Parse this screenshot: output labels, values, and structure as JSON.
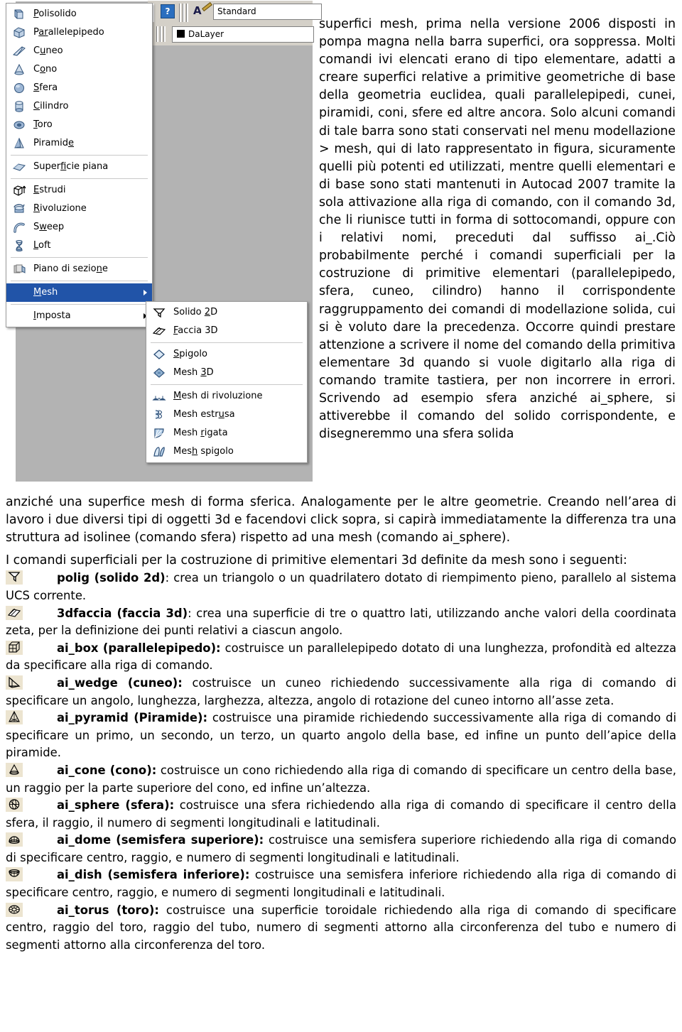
{
  "screenshot": {
    "toolbar": {
      "help_label": "?",
      "text_style_value": "Standard",
      "layer_value": "DaLayer"
    },
    "menu_main": {
      "items": [
        {
          "label": "Polisolido",
          "accel": "P",
          "icon": "polysolid-icon",
          "type": "item"
        },
        {
          "label": "Parallelepipedo",
          "accel": "ar",
          "icon": "box-icon",
          "type": "item"
        },
        {
          "label": "Cuneo",
          "accel": "u",
          "icon": "wedge-icon",
          "type": "item"
        },
        {
          "label": "Cono",
          "accel": "o",
          "icon": "cone-icon",
          "type": "item"
        },
        {
          "label": "Sfera",
          "accel": "S",
          "icon": "sphere-icon",
          "type": "item"
        },
        {
          "label": "Cilindro",
          "accel": "C",
          "icon": "cylinder-icon",
          "type": "item"
        },
        {
          "label": "Toro",
          "accel": "T",
          "icon": "torus-icon",
          "type": "item"
        },
        {
          "label": "Piramide",
          "accel": "d",
          "icon": "pyramid-icon",
          "type": "item"
        },
        {
          "type": "separator"
        },
        {
          "label": "Superficie piana",
          "accel": "f",
          "icon": "planar-surface-icon",
          "type": "item"
        },
        {
          "type": "separator"
        },
        {
          "label": "Estrudi",
          "accel": "E",
          "icon": "extrude-icon",
          "type": "item"
        },
        {
          "label": "Rivoluzione",
          "accel": "R",
          "icon": "revolve-icon",
          "type": "item"
        },
        {
          "label": "Sweep",
          "accel": "w",
          "icon": "sweep-icon",
          "type": "item"
        },
        {
          "label": "Loft",
          "accel": "L",
          "icon": "loft-icon",
          "type": "item"
        },
        {
          "type": "separator"
        },
        {
          "label": "Piano di sezione",
          "accel": "n",
          "icon": "section-plane-icon",
          "type": "item"
        },
        {
          "type": "separator"
        },
        {
          "label": "Mesh",
          "accel": "M",
          "icon": "none",
          "type": "submenu",
          "selected": true
        },
        {
          "type": "separator"
        },
        {
          "label": "Imposta",
          "accel": "I",
          "icon": "none",
          "type": "submenu"
        }
      ]
    },
    "menu_sub": {
      "items": [
        {
          "label": "Solido 2D",
          "accel": "2",
          "icon": "solid2d-icon",
          "type": "item"
        },
        {
          "label": "Faccia 3D",
          "accel": "F",
          "icon": "face3d-icon",
          "type": "item"
        },
        {
          "type": "separator"
        },
        {
          "label": "Spigolo",
          "accel": "S",
          "icon": "edge-icon",
          "type": "item"
        },
        {
          "label": "Mesh 3D",
          "accel": "3",
          "icon": "mesh3d-icon",
          "type": "item"
        },
        {
          "type": "separator"
        },
        {
          "label": "Mesh di rivoluzione",
          "accel": "M",
          "icon": "revolved-mesh-icon",
          "type": "item"
        },
        {
          "label": "Mesh estrusa",
          "accel": "u",
          "icon": "extruded-mesh-icon",
          "type": "item"
        },
        {
          "label": "Mesh rigata",
          "accel": "r",
          "icon": "ruled-mesh-icon",
          "type": "item"
        },
        {
          "label": "Mesh spigolo",
          "accel": "h",
          "icon": "edge-mesh-icon",
          "type": "item"
        }
      ]
    }
  },
  "body": {
    "right_column": "superfici mesh, prima nella versione 2006 disposti in pompa magna nella barra superfici, ora soppressa. Molti comandi ivi elencati erano di tipo elementare, adatti a creare superfici relative a primitive geometriche di base della geometria euclidea, quali parallelepipedi, cunei, piramidi, coni, sfere ed altre ancora. Solo alcuni comandi di tale barra sono stati conservati nel menu modellazione > mesh, qui di lato rappresentato in figura, sicuramente quelli più potenti ed utilizzati, mentre quelli elementari e di base sono stati mantenuti in Autocad 2007 tramite la sola attivazione alla riga di comando, con il comando 3d, che li riunisce tutti in forma di sottocomandi, oppure con i relativi nomi, preceduti dal suffisso ai_.Ciò probabilmente perché i comandi superficiali per la costruzione di primitive elementari (parallelepipedo, sfera, cuneo, cilindro) hanno il corrispondente raggruppamento dei comandi di modellazione solida, cui si è voluto dare la precedenza. Occorre quindi prestare attenzione a scrivere il nome del comando della primitiva elementare 3d quando si vuole digitarlo alla riga di comando tramite tastiera, per non incorrere in errori. Scrivendo ad esempio sfera anziché ai_sphere, si attiverebbe il comando del solido corrispondente, e disegneremmo una sfera solida",
    "continuation": "anziché una superfice mesh di forma sferica.    Analogamente per le altre geometrie. Creando nell’area di lavoro i due diversi tipi di oggetti 3d e facendovi click sopra, si capirà immediatamente la differenza tra una struttura ad isolinee (comando sfera) rispetto ad una mesh (comando ai_sphere).",
    "intro": " I comandi superficiali per la costruzione di primitive elementari 3d definite da mesh sono i seguenti:",
    "commands": [
      {
        "icon": "solid2d-icon",
        "name": "polig (solido 2d)",
        "sep": ": ",
        "desc": "crea un triangolo o un quadrilatero dotato di riempimento pieno, parallelo al sistema UCS corrente."
      },
      {
        "icon": "face3d-icon",
        "name": "3dfaccia (faccia 3d)",
        "sep": ": ",
        "desc": "crea una superficie di tre o quattro lati, utilizzando anche valori della coordinata zeta, per la definizione dei punti relativi a ciascun angolo."
      },
      {
        "icon": "box-wire-icon",
        "name": "ai_box (parallelepipedo):",
        "sep": " ",
        "desc": "costruisce un parallelepipedo dotato di una lunghezza, profondità ed altezza da specificare alla riga di comando."
      },
      {
        "icon": "wedge-wire-icon",
        "name": "ai_wedge (cuneo):",
        "sep": " ",
        "desc": "costruisce un cuneo richiedendo successivamente alla riga di comando di specificare un angolo, lunghezza, larghezza, altezza, angolo di rotazione del cuneo intorno all’asse zeta."
      },
      {
        "icon": "pyramid-wire-icon",
        "name": "ai_pyramid (Piramide):",
        "sep": " ",
        "desc": "costruisce una piramide richiedendo successivamente alla riga di comando di specificare un primo, un secondo, un terzo, un quarto angolo della base, ed infine un punto dell’apice della piramide."
      },
      {
        "icon": "cone-wire-icon",
        "name": "ai_cone (cono):",
        "sep": " ",
        "desc": "costruisce un cono richiedendo alla riga di comando di specificare un centro della base, un raggio per la parte superiore del cono, ed infine un’altezza."
      },
      {
        "icon": "sphere-wire-icon",
        "name": "ai_sphere (sfera):",
        "sep": " ",
        "desc": "costruisce una sfera richiedendo alla riga di comando di specificare il centro della sfera, il raggio, il numero di segmenti longitudinali e latitudinali."
      },
      {
        "icon": "dome-wire-icon",
        "name": "ai_dome (semisfera superiore):",
        "sep": " ",
        "desc": "costruisce una semisfera superiore richiedendo alla riga di comando di specificare centro, raggio, e numero di segmenti longitudinali e latitudinali."
      },
      {
        "icon": "dish-wire-icon",
        "name": "ai_dish (semisfera inferiore):",
        "sep": " ",
        "desc": "costruisce una semisfera inferiore richiedendo alla riga di comando di specificare centro, raggio, e numero di segmenti longitudinali e latitudinali."
      },
      {
        "icon": "torus-wire-icon",
        "name": "ai_torus (toro):",
        "sep": " ",
        "desc": "costruisce una superficie toroidale richiedendo alla riga di comando di specificare centro, raggio del toro, raggio del tubo, numero di segmenti attorno alla circonferenza del tubo e numero di segmenti attorno alla circonferenza del toro."
      }
    ]
  },
  "colors": {
    "menu_highlight": "#2154a8",
    "acad_background": "#b3b3b3",
    "toolbar_face": "#d4d0c8",
    "icon_background": "#ece4d0"
  }
}
